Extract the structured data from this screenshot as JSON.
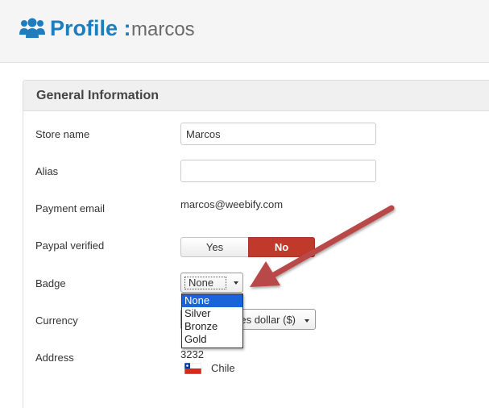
{
  "header": {
    "icon": "users-icon",
    "title": "Profile :",
    "username": "marcos"
  },
  "panel": {
    "title": "General Information"
  },
  "form": {
    "store_name": {
      "label": "Store name",
      "value": "Marcos"
    },
    "alias": {
      "label": "Alias",
      "value": ""
    },
    "payment_email": {
      "label": "Payment email",
      "value": "marcos@weebify.com"
    },
    "paypal_verified": {
      "label": "Paypal verified",
      "yes_label": "Yes",
      "no_label": "No",
      "selected": "No"
    },
    "badge": {
      "label": "Badge",
      "selected": "None",
      "options": [
        "None",
        "Silver",
        "Bronze",
        "Gold"
      ]
    },
    "currency": {
      "label": "Currency",
      "value": "es dollar ($)"
    },
    "address": {
      "label": "Address",
      "line": "3232",
      "country": "Chile"
    }
  },
  "colors": {
    "title_blue": "#1e7dbf",
    "toggle_active_red": "#c0392b",
    "dropdown_highlight": "#1a63d8",
    "annotation_arrow": "#b94a48"
  }
}
